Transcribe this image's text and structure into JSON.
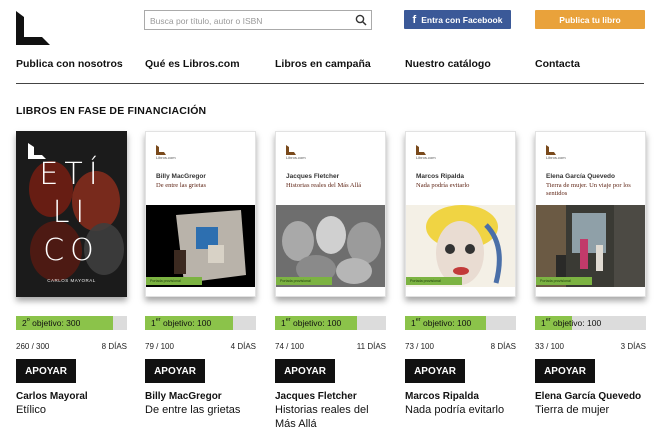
{
  "header": {
    "search_placeholder": "Busca por título, autor o ISBN",
    "facebook_label": "Entra con Facebook",
    "facebook_glyph": "f",
    "publish_label": "Publica tu libro"
  },
  "nav": [
    {
      "label": "Publica con nosotros"
    },
    {
      "label": "Qué es Libros.com"
    },
    {
      "label": "Libros en campaña"
    },
    {
      "label": "Nuestro catálogo"
    },
    {
      "label": "Contacta"
    }
  ],
  "section_title": "LIBROS EN FASE DE FINANCIACIÓN",
  "colors": {
    "accent_orange": "#e9a23b",
    "facebook_blue": "#3b5998",
    "progress_green": "#8bc34a",
    "button_black": "#111111"
  },
  "books": [
    {
      "cover": {
        "type": "dark",
        "big_text_1": "ETÍ",
        "big_text_2": "LI",
        "big_text_3": "CO",
        "author_caption": "CARLOS MAYORAL"
      },
      "objective_num": "2",
      "objective_sup": "o",
      "objective_rest": " objetivo: 300",
      "progress": 0.87,
      "count": "260 / 300",
      "days": "8 DÍAS",
      "button": "APOYAR",
      "author": "Carlos Mayoral",
      "title": "Etílico"
    },
    {
      "cover": {
        "type": "white",
        "pub": "Libros.com",
        "author": "Billy MacGregor",
        "title": "De entre las grietas",
        "provisional": "Portada provisional",
        "scene": "room"
      },
      "objective_num": "1",
      "objective_sup": "er",
      "objective_rest": " objetivo: 100",
      "progress": 0.79,
      "count": "79 / 100",
      "days": "4 DÍAS",
      "button": "APOYAR",
      "author": "Billy MacGregor",
      "title": "De entre las grietas"
    },
    {
      "cover": {
        "type": "white",
        "pub": "Libros.com",
        "author": "Jacques Fletcher",
        "title": "Historias reales del Más Allá",
        "provisional": "Portada provisional",
        "scene": "faces"
      },
      "objective_num": "1",
      "objective_sup": "er",
      "objective_rest": " objetivo: 100",
      "progress": 0.74,
      "count": "74 / 100",
      "days": "11 DÍAS",
      "button": "APOYAR",
      "author": "Jacques Fletcher",
      "title": "Historias reales del Más Allá"
    },
    {
      "cover": {
        "type": "white",
        "pub": "Libros.com",
        "author": "Marcos Ripalda",
        "title": "Nada podría evitarlo",
        "provisional": "Portada provisional",
        "scene": "portrait"
      },
      "objective_num": "1",
      "objective_sup": "er",
      "objective_rest": " objetivo: 100",
      "progress": 0.73,
      "count": "73 / 100",
      "days": "8 DÍAS",
      "button": "APOYAR",
      "author": "Marcos Ripalda",
      "title": "Nada podría evitarlo"
    },
    {
      "cover": {
        "type": "white",
        "pub": "Libros.com",
        "author": "Elena García Quevedo",
        "title": "Tierra de mujer. Un viaje por los sentidos",
        "provisional": "Portada provisional",
        "scene": "street"
      },
      "objective_num": "1",
      "objective_sup": "er",
      "objective_rest": " objetivo: 100",
      "progress": 0.33,
      "count": "33 / 100",
      "days": "3 DÍAS",
      "button": "APOYAR",
      "author": "Elena García Quevedo",
      "title": "Tierra de mujer"
    }
  ]
}
